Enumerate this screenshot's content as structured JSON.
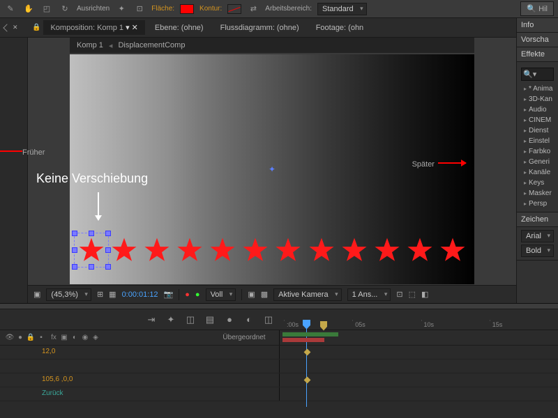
{
  "topbar": {
    "align": "Ausrichten",
    "fill": "Fläche:",
    "stroke": "Kontur:",
    "workspace_lbl": "Arbeitsbereich:",
    "workspace": "Standard",
    "help": "Hil"
  },
  "tabs": {
    "composition_lbl": "Komposition: Komp 1",
    "layer": "Ebene: (ohne)",
    "flowchart": "Flussdiagramm: (ohne)",
    "footage": "Footage: (ohn"
  },
  "crumb": {
    "comp": "Komp 1",
    "sub": "DisplacementComp"
  },
  "annotations": {
    "earlier": "Früher",
    "later": "Später",
    "noshift": "Keine Verschiebung"
  },
  "viewer": {
    "zoom": "(45,3%)",
    "time": "0:00:01:12",
    "res": "Voll",
    "camera": "Aktive Kamera",
    "views": "1 Ans..."
  },
  "side": {
    "info": "Info",
    "preview": "Vorscha",
    "effects": "Effekte",
    "search": "",
    "items": [
      "* Anima",
      "3D-Kan",
      "Audio",
      "CINEM",
      "Dienst",
      "Einstel",
      "Farbko",
      "Generi",
      "Kanäle",
      "Keys",
      "Masker",
      "Persp"
    ],
    "char": "Zeichen",
    "font": "Arial",
    "weight": "Bold"
  },
  "timeline": {
    "parent": "Übergeordnet",
    "ticks": [
      ":00s",
      "05s",
      "10s",
      "15s"
    ],
    "rows": [
      {
        "val": "12,0",
        "cls": "orange",
        "kf": 36
      },
      {
        "val": "",
        "cls": "",
        "kf": null
      },
      {
        "val": "105,6 ,0,0",
        "cls": "orange",
        "kf": 36
      },
      {
        "val": "Zurück",
        "cls": "teal",
        "kf": null
      }
    ]
  }
}
